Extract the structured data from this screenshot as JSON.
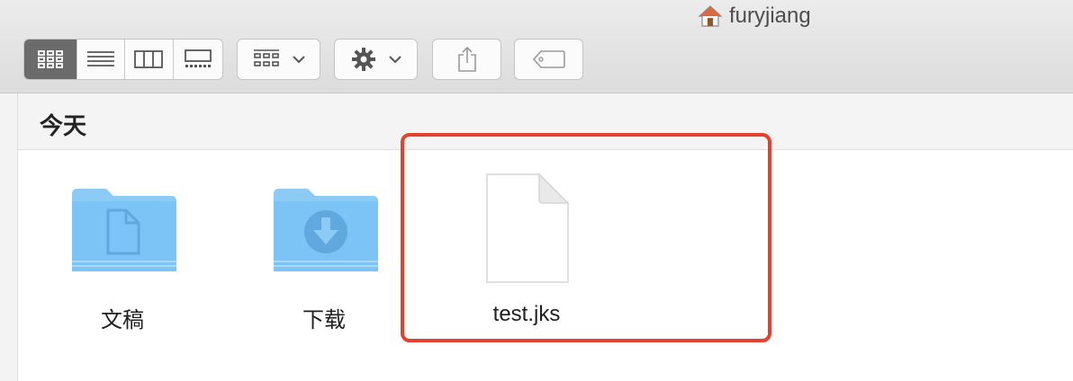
{
  "window": {
    "title": "furyjiang",
    "title_icon": "home-icon"
  },
  "toolbar": {
    "view_modes": [
      "icon-view",
      "list-view",
      "column-view",
      "gallery-view"
    ],
    "active_view": "icon-view",
    "group_icon": "group-by-icon",
    "action_icon": "gear-icon",
    "share_icon": "share-icon",
    "tag_icon": "tag-icon"
  },
  "section": {
    "title": "今天"
  },
  "files": [
    {
      "name": "文稿",
      "icon": "documents-folder-icon"
    },
    {
      "name": "下载",
      "icon": "downloads-folder-icon"
    },
    {
      "name": "test.jks",
      "icon": "document-file-icon"
    }
  ],
  "colors": {
    "highlight": "#e5412f",
    "folder": "#7cc4f5"
  }
}
